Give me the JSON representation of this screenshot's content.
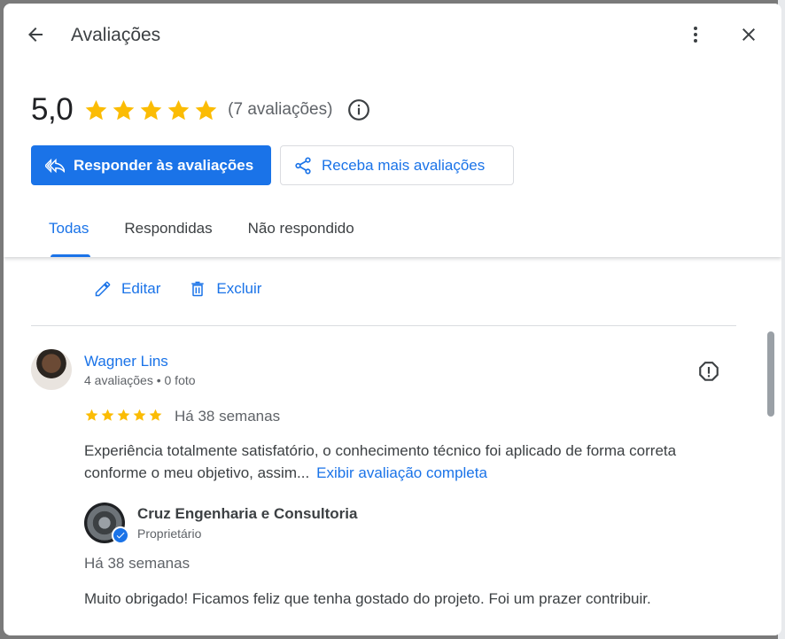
{
  "dialog": {
    "title": "Avaliações",
    "icons": {
      "back": "arrow-back-icon",
      "more": "more-vert-icon",
      "close": "close-icon"
    }
  },
  "summary": {
    "score": "5,0",
    "stars": 5,
    "count_label": "(7 avaliações)",
    "info_icon": "info-icon"
  },
  "buttons": {
    "reply_label": "Responder às avaliações",
    "get_more_label": "Receba mais avaliações"
  },
  "tabs": [
    {
      "label": "Todas",
      "active": true
    },
    {
      "label": "Respondidas",
      "active": false
    },
    {
      "label": "Não respondido",
      "active": false
    }
  ],
  "actions": {
    "edit_label": "Editar",
    "delete_label": "Excluir"
  },
  "review": {
    "author": "Wagner Lins",
    "meta": "4 avaliações • 0 foto",
    "stars": 5,
    "time": "Há 38 semanas",
    "text": "Experiência totalmente satisfatório, o conhecimento técnico foi aplicado de forma correta conforme o meu objetivo, assim...",
    "more_link": "Exibir avaliação completa",
    "flag_icon": "report-flag-icon"
  },
  "reply": {
    "owner": "Cruz Engenharia e Consultoria",
    "role": "Proprietário",
    "time": "Há 38 semanas",
    "text": "Muito obrigado! Ficamos feliz que tenha gostado do projeto. Foi um prazer contribuir."
  },
  "colors": {
    "accent": "#1a73e8",
    "star": "#fbbc04",
    "text": "#202124",
    "muted": "#5f6368"
  }
}
